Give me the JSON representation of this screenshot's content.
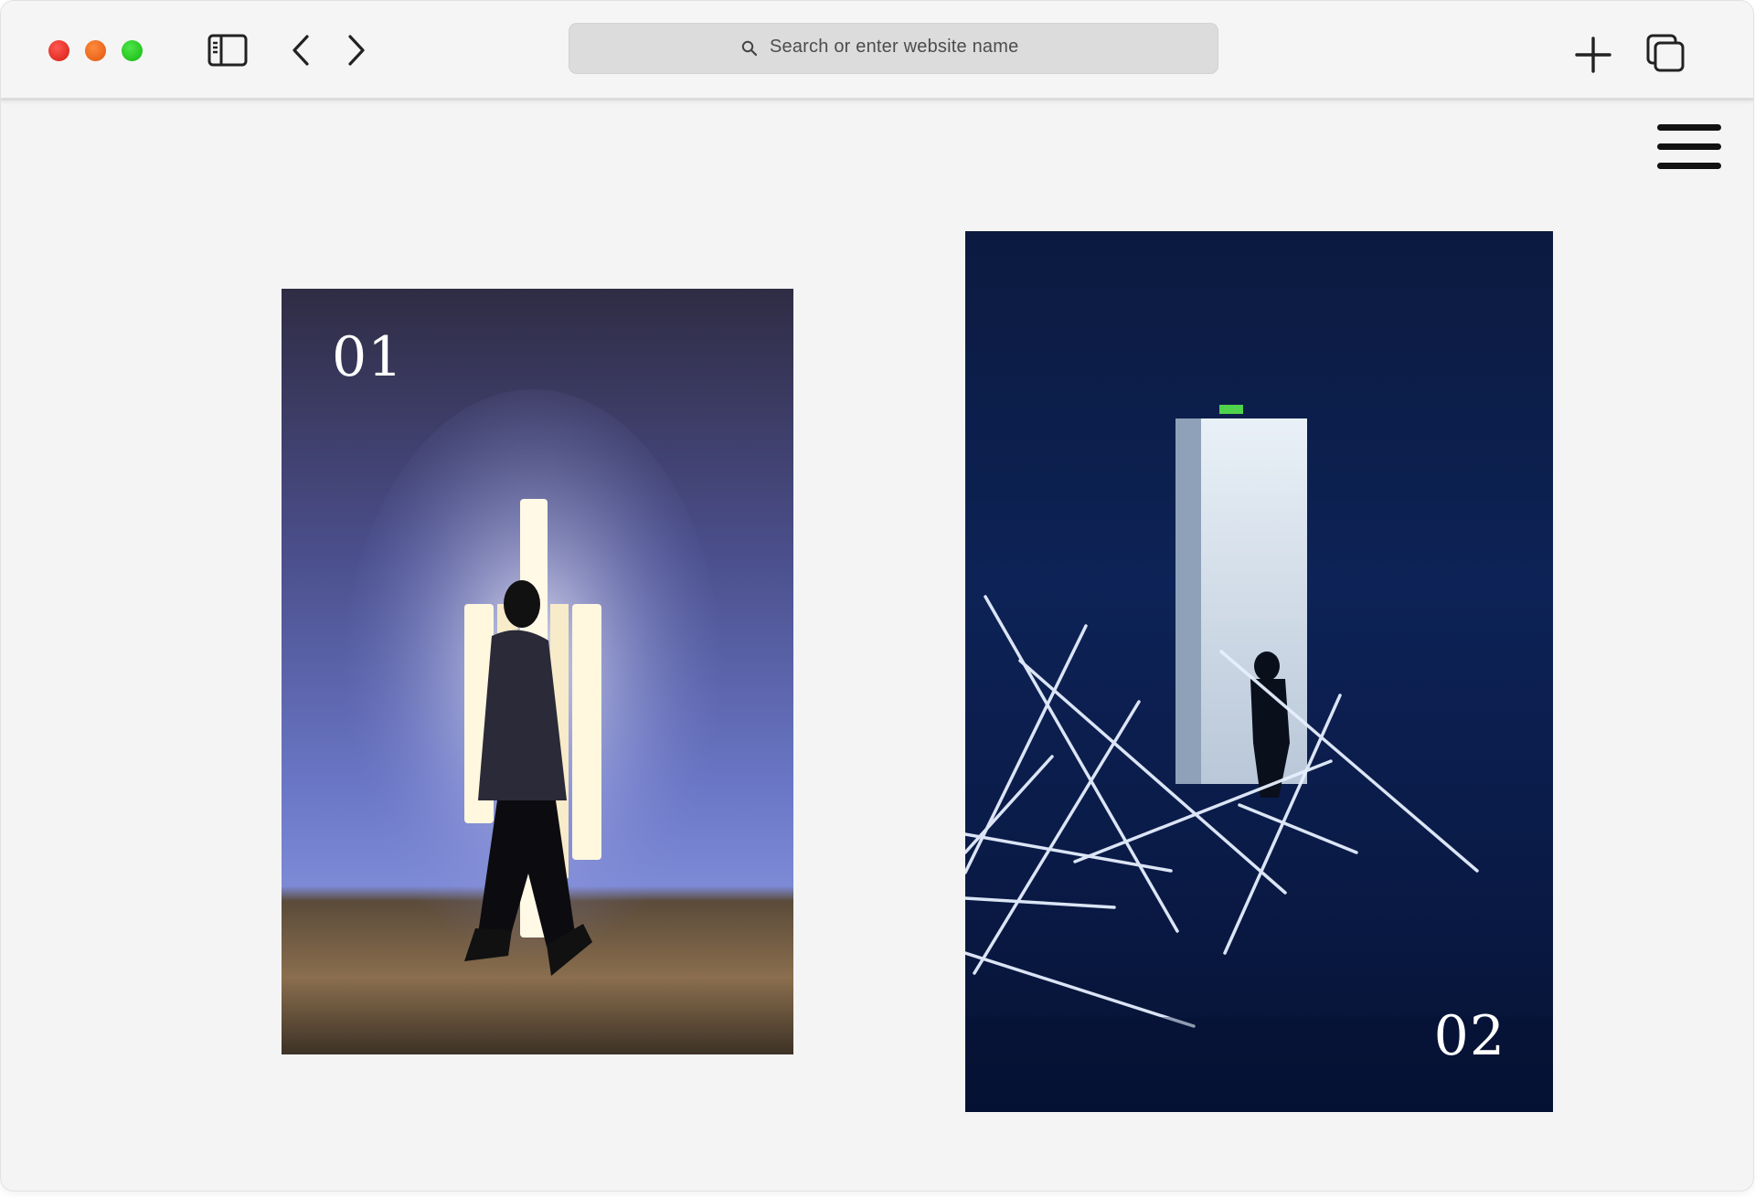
{
  "browser": {
    "address_bar": {
      "placeholder": "Search or enter website name"
    },
    "icons": [
      "sidebar-icon",
      "back-icon",
      "forward-icon",
      "new-tab-icon",
      "tabs-overview-icon",
      "search-icon"
    ]
  },
  "page": {
    "menu_icon": "hamburger-menu-icon",
    "cards": [
      {
        "number": "01",
        "image": "person-walking-past-light-installation"
      },
      {
        "number": "02",
        "image": "neon-tube-installation-dark-room"
      }
    ]
  },
  "colors": {
    "accent_red": "#e3241a",
    "accent_orange": "#f26a1f",
    "accent_green": "#2ecc1f",
    "text_dark": "#111111"
  }
}
